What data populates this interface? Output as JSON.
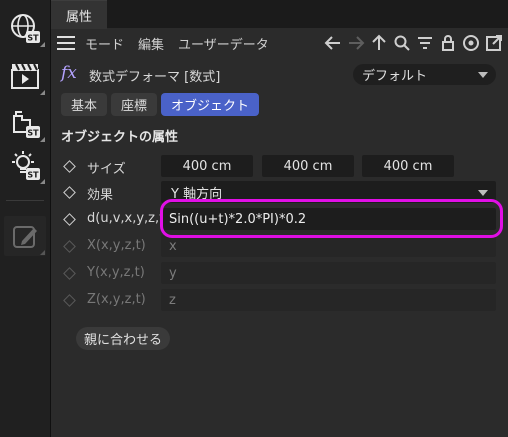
{
  "toolbar": {
    "buttons": [
      {
        "name": "globe-st-icon",
        "badge": "ST"
      },
      {
        "name": "clapperboard-icon",
        "badge": ""
      },
      {
        "name": "camera-st-icon",
        "badge": "ST"
      },
      {
        "name": "light-st-icon",
        "badge": "ST"
      },
      {
        "name": "edit-pencil-icon",
        "badge": ""
      }
    ]
  },
  "tab": {
    "label": "属性"
  },
  "menu": {
    "items": [
      "モード",
      "編集",
      "ユーザーデータ"
    ],
    "nav_icons": [
      "arrow-left-icon",
      "arrow-right-icon",
      "arrow-up-icon",
      "search-icon",
      "filter-icon",
      "lock-icon",
      "target-icon",
      "open-external-icon"
    ]
  },
  "object": {
    "icon": "fx",
    "name": "数式デフォーマ [数式]",
    "preset": "デフォルト"
  },
  "subtabs": [
    {
      "label": "基本",
      "active": false
    },
    {
      "label": "座標",
      "active": false
    },
    {
      "label": "オブジェクト",
      "active": true
    }
  ],
  "section": {
    "title": "オブジェクトの属性"
  },
  "properties": {
    "size": {
      "label": "サイズ",
      "values": [
        "400 cm",
        "400 cm",
        "400 cm"
      ]
    },
    "effect": {
      "label": "効果",
      "value": "Y 軸方向"
    },
    "d": {
      "label": "d(u,v,x,y,z,t)",
      "value": "Sin((u+t)*2.0*PI)*0.2"
    },
    "x": {
      "label": "X(x,y,z,t)",
      "value": "x"
    },
    "y": {
      "label": "Y(x,y,z,t)",
      "value": "y"
    },
    "z": {
      "label": "Z(x,y,z,t)",
      "value": "z"
    }
  },
  "fit_button": {
    "label": "親に合わせる"
  },
  "colors": {
    "highlight": "#e10fe6",
    "active_tab": "#4a62c8",
    "fx": "#b4a3ff"
  }
}
